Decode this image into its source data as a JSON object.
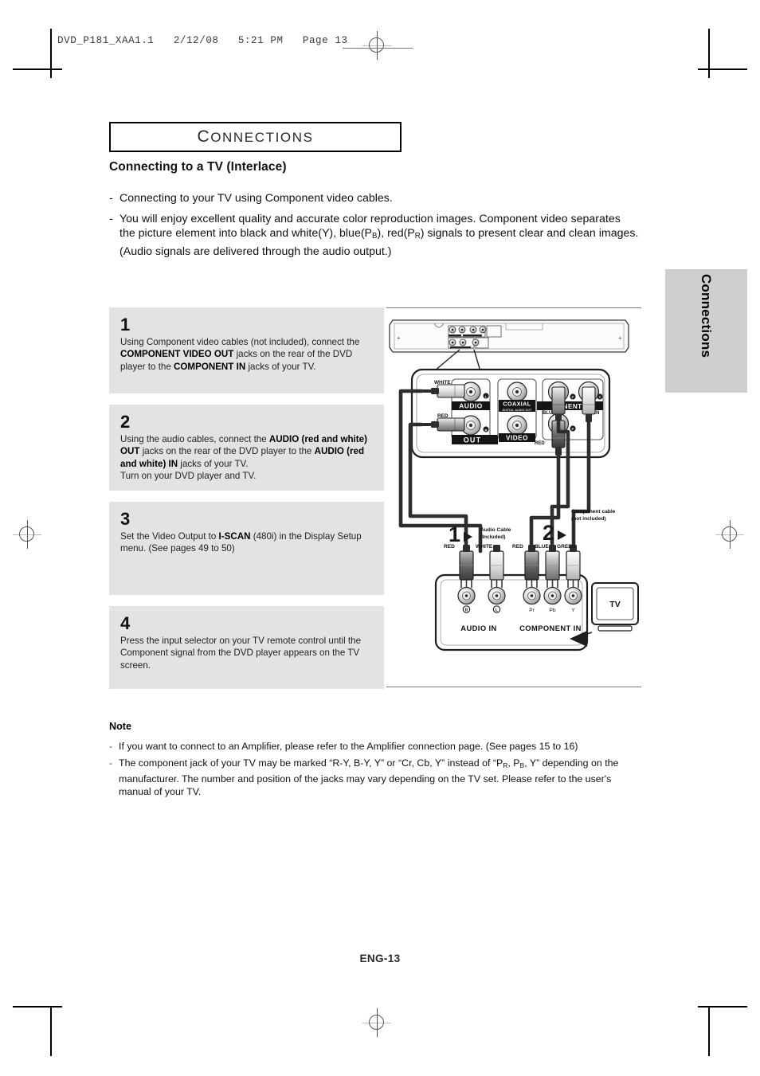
{
  "print_marks": {
    "slug_text": "DVD_P181_XAA1.1   2/12/08   5:21 PM   Page 13"
  },
  "side_tab": {
    "label": "Connections"
  },
  "chapter": {
    "title_first_letter": "C",
    "title_rest": "ONNECTIONS"
  },
  "section": {
    "heading": "Connecting to a TV (Interlace)",
    "intro": [
      {
        "bullet": "-",
        "text": "Connecting to your TV using Component video cables."
      },
      {
        "bullet": "-",
        "text": "You will enjoy excellent quality and accurate color reproduction images. Component video separates the picture element into black and white(Y), blue(P<sub>B</sub>), red(P<sub>R</sub>) signals to present clear and clean images. (Audio signals are delivered through the audio output.)"
      }
    ]
  },
  "steps": [
    {
      "number": "1",
      "text": "Using Component video cables (not included), connect the <b>COMPONENT VIDEO OUT</b> jacks on the rear of the DVD player to the <b>COMPONENT IN</b> jacks of your TV."
    },
    {
      "number": "2",
      "text": "Using the audio cables, connect the <b>AUDIO (red and white) OUT</b> jacks on the rear of the DVD player to the <b>AUDIO (red and white) IN</b> jacks of your TV.<br>Turn on your DVD player and TV."
    },
    {
      "number": "3",
      "text": "Set the Video Output to <b>I-SCAN</b> (480i) in the Display Setup menu. (See pages 49 to 50)"
    },
    {
      "number": "4",
      "text": "Press the input selector on your TV remote control until the Component signal from the DVD player appears on the TV screen."
    }
  ],
  "diagram": {
    "dvd_rear_panel": {
      "jack_group_labels": {
        "audio": "AUDIO",
        "out": "OUT",
        "coaxial": "COAXIAL",
        "coaxial_sub": "DIGITAL AUDIO OUT",
        "video": "VIDEO",
        "component": "PONENT O"
      },
      "jack_marks": {
        "audio_left": "L",
        "audio_right": "R",
        "component_pr": "P",
        "component_pb": "P",
        "component_y": "Y"
      },
      "cable_labels": {
        "white": "WHITE",
        "red": "RED",
        "blue": "BLUE",
        "green": "GREEN",
        "red2": "RED"
      }
    },
    "callouts": {
      "step1_marker": "1",
      "step1_text_line1": "Audio Cable",
      "step1_text_line2": "(Included)",
      "step2_marker": "2",
      "step2_text_line1": "Component cable",
      "step2_text_line2": "(not included)"
    },
    "tv_panel": {
      "audio_in_label": "AUDIO IN",
      "component_in_label": "COMPONENT IN",
      "plug_labels": {
        "red": "RED",
        "white": "WHITE",
        "red2": "RED",
        "blue": "BLUE",
        "green": "GREEN"
      },
      "jack_marks": {
        "audio_r": "R",
        "audio_l": "L",
        "pr": "Pr",
        "pb": "Pb",
        "y": "Y"
      }
    },
    "tv_screen_label": "TV"
  },
  "note": {
    "heading": "Note",
    "items": [
      {
        "bullet": "-",
        "text": "If you want to connect to an Amplifier, please refer to the Amplifier connection page. (See pages 15 to 16)"
      },
      {
        "bullet": "-",
        "text": "The component jack of your TV may be marked “R-Y, B-Y, Y” or “Cr, Cb, Y” instead of “P<sub>R</sub>, P<sub>B</sub>, Y” depending on the manufacturer. The number and position of the jacks may vary depending on the TV set. Please refer to the user's manual of your TV."
      }
    ]
  },
  "footer": {
    "page_label": "ENG-13"
  }
}
